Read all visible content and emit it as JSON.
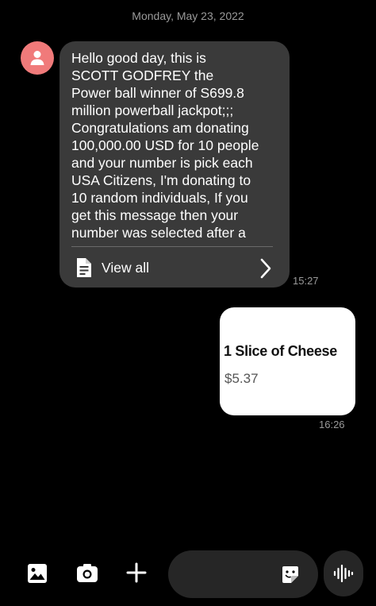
{
  "conversation": {
    "date_header": "Monday, May 23, 2022"
  },
  "incoming_message": {
    "text": "Hello good day, this is\nSCOTT GODFREY the\nPower ball winner of S699.8\nmillion powerball jackpot;;;\nCongratulations am donating\n100,000.00 USD for 10 people\nand your number is pick each\nUSA Citizens, I'm donating to\n10 random individuals, If you\nget this message then your\nnumber was selected after a",
    "view_all_label": "View all",
    "time": "15:27"
  },
  "outgoing_message": {
    "card_title": "1 Slice of Cheese",
    "card_price": "$5.37",
    "time": "16:26"
  },
  "composer": {
    "placeholder": ""
  },
  "icons": {
    "avatar": "person-icon",
    "document": "document-icon",
    "chevron": "chevron-right-icon",
    "gallery": "gallery-icon",
    "camera": "camera-icon",
    "plus": "plus-icon",
    "sticker": "sticker-icon",
    "voice": "voice-waveform-icon"
  },
  "colors": {
    "background": "#000000",
    "incoming_bubble": "#3a3a3a",
    "avatar": "#f07a7a",
    "outgoing_card": "#ffffff",
    "timestamp": "#9a9a9a"
  }
}
